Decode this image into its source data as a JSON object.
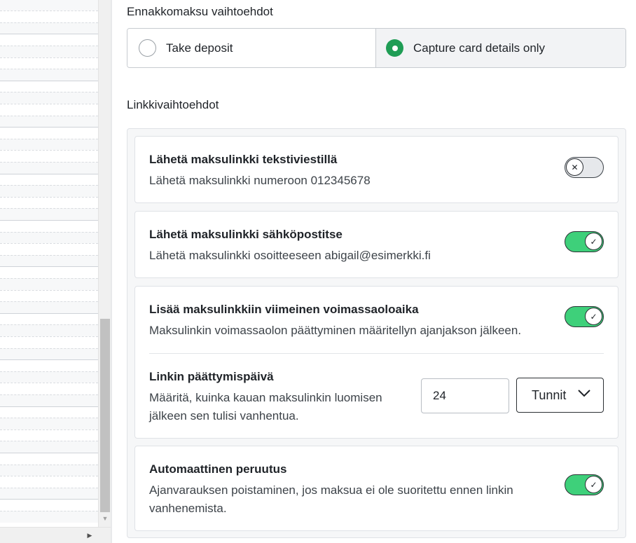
{
  "deposit_options": {
    "title": "Ennakkomaksu vaihtoehdot",
    "take_deposit_label": "Take deposit",
    "capture_card_label": "Capture card details only",
    "selected": "capture_card"
  },
  "link_options": {
    "title": "Linkkivaihtoehdot",
    "sms": {
      "title": "Lähetä maksulinkki tekstiviestillä",
      "description": "Lähetä maksulinkki numeroon 012345678",
      "enabled": false,
      "knob_icon": "x-icon"
    },
    "email": {
      "title": "Lähetä maksulinkki sähköpostitse",
      "description": "Lähetä maksulinkki osoitteeseen abigail@esimerkki.fi",
      "enabled": true,
      "knob_icon": "check-icon"
    },
    "expiry": {
      "title": "Lisää maksulinkkiin viimeinen voimassaoloaika",
      "description": "Maksulinkin voimassaolon päättyminen määritellyn ajanjakson jälkeen.",
      "enabled": true,
      "knob_icon": "check-icon",
      "end_date": {
        "title": "Linkin päättymispäivä",
        "description": "Määritä, kuinka kauan maksulinkin luomisen jälkeen sen tulisi vanhentua.",
        "value": "24",
        "unit": "Tunnit"
      }
    },
    "auto_cancel": {
      "title": "Automaattinen peruutus",
      "description": "Ajanvarauksen poistaminen, jos maksua ei ole suoritettu ennen linkin vanhenemista.",
      "enabled": true,
      "knob_icon": "check-icon"
    }
  },
  "colors": {
    "toggle_on": "#3ed07a",
    "radio_selected": "#1f9d55"
  }
}
